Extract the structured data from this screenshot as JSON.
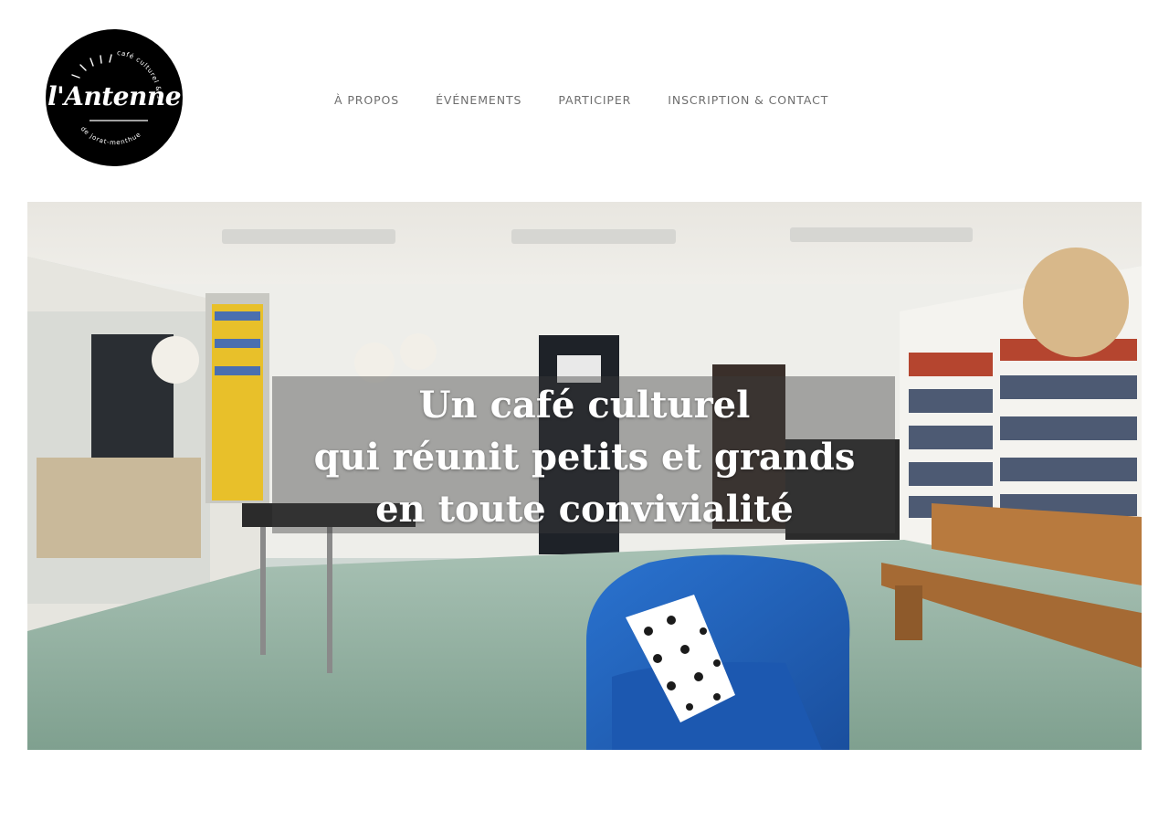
{
  "logo": {
    "name": "l'Antenne",
    "arc_top": "café culturel & social",
    "arc_bottom": "de jorat-menthue"
  },
  "nav": {
    "items": [
      {
        "label": "À PROPOS"
      },
      {
        "label": "ÉVÉNEMENTS"
      },
      {
        "label": "PARTICIPER"
      },
      {
        "label": "INSCRIPTION & CONTACT"
      }
    ]
  },
  "hero": {
    "lines": [
      "Un café culturel",
      "qui réunit petits et grands",
      "en toute convivialité"
    ]
  },
  "colors": {
    "nav_text": "#6e6e6e",
    "logo_bg": "#000000",
    "armchair": "#1f5fb8",
    "floor": "#8fb0a0"
  }
}
